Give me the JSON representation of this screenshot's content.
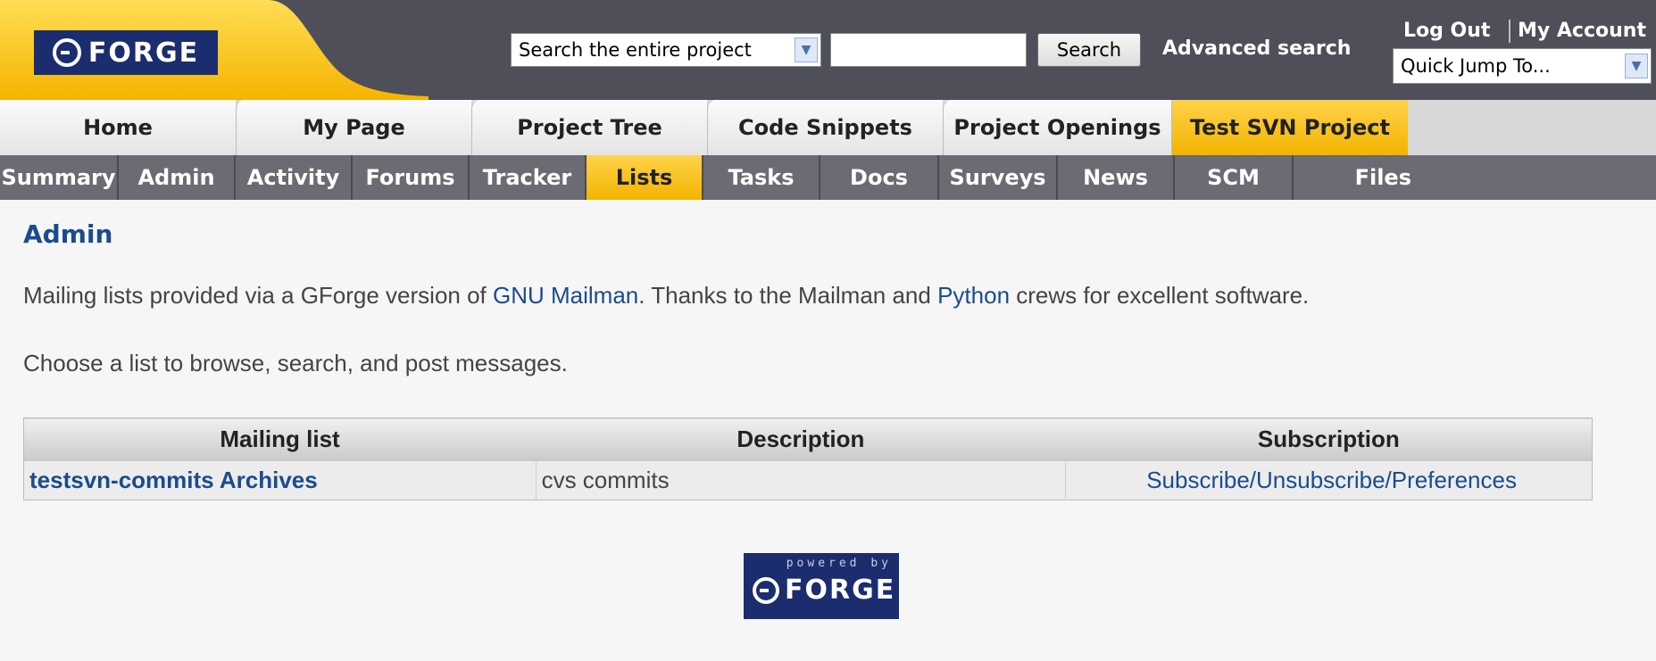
{
  "header": {
    "logo_text": "FORGE",
    "search_scope": "Search the entire project",
    "search_value": "",
    "search_button": "Search",
    "advanced_search": "Advanced search",
    "logout": "Log Out",
    "my_account": "My Account",
    "quick_jump": "Quick Jump To..."
  },
  "top_tabs": [
    {
      "label": "Home",
      "active": false
    },
    {
      "label": "My Page",
      "active": false
    },
    {
      "label": "Project Tree",
      "active": false
    },
    {
      "label": "Code Snippets",
      "active": false
    },
    {
      "label": "Project Openings",
      "active": false
    },
    {
      "label": "Test SVN Project",
      "active": true
    }
  ],
  "sub_tabs": [
    {
      "label": "Summary",
      "active": false
    },
    {
      "label": "Admin",
      "active": false
    },
    {
      "label": "Activity",
      "active": false
    },
    {
      "label": "Forums",
      "active": false
    },
    {
      "label": "Tracker",
      "active": false
    },
    {
      "label": "Lists",
      "active": true
    },
    {
      "label": "Tasks",
      "active": false
    },
    {
      "label": "Docs",
      "active": false
    },
    {
      "label": "Surveys",
      "active": false
    },
    {
      "label": "News",
      "active": false
    },
    {
      "label": "SCM",
      "active": false
    },
    {
      "label": "Files",
      "active": false
    }
  ],
  "content": {
    "title": "Admin",
    "intro_prefix": "Mailing lists provided via a GForge version of ",
    "intro_link1": "GNU Mailman",
    "intro_middle": ". Thanks to the Mailman and ",
    "intro_link2": "Python",
    "intro_suffix": " crews for excellent software.",
    "choose": "Choose a list to browse, search, and post messages.",
    "table": {
      "headers": [
        "Mailing list",
        "Description",
        "Subscription"
      ],
      "rows": [
        {
          "name": "testsvn-commits Archives",
          "description": "cvs commits",
          "subscription": "Subscribe/Unsubscribe/Preferences"
        }
      ]
    },
    "powered_by": "powered by",
    "footer_logo_text": "FORGE"
  },
  "colors": {
    "header_bg": "#4f4f59",
    "accent_yellow": "#ffc20e",
    "logo_blue": "#1b2d6e",
    "link_blue": "#1a4c8c"
  }
}
